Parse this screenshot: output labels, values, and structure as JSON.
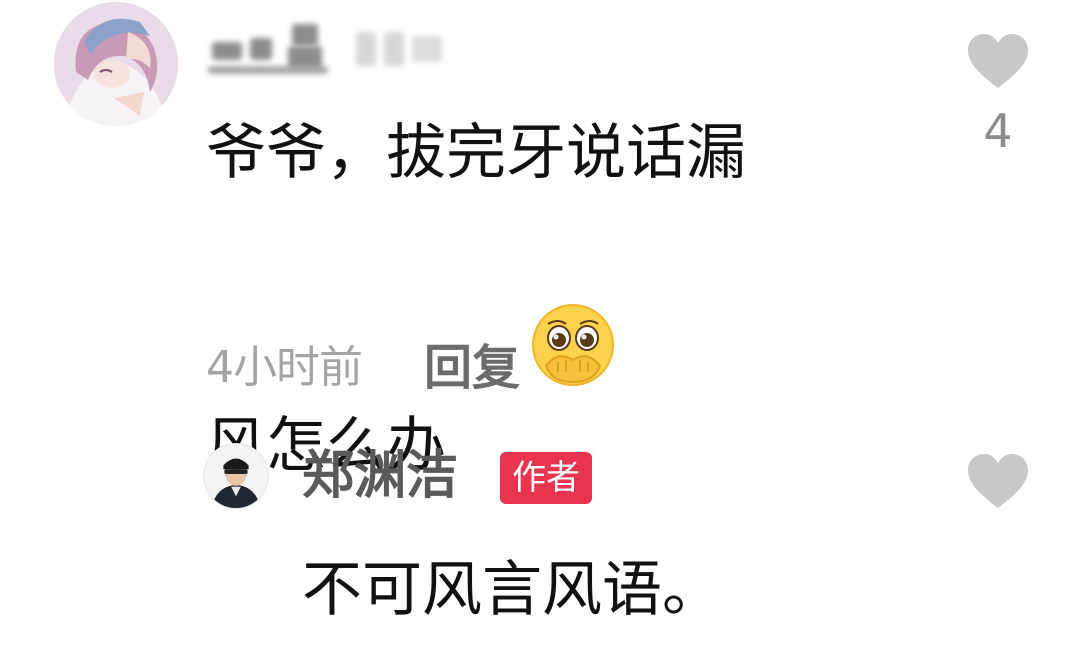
{
  "comment": {
    "username": "",
    "text_line1": "爷爷，拔完牙说话漏",
    "text_line2": "风怎么办",
    "emoji": "pleading-face-emoji",
    "timestamp": "4小时前",
    "reply_label": "回复",
    "like_count": "4"
  },
  "reply": {
    "username": "郑渊洁",
    "badge": "作者",
    "text": "不可风言风语。"
  },
  "colors": {
    "badge_bg": "#e8344e",
    "like_icon": "#c8c8c8",
    "meta_text": "#a4a4a4"
  }
}
